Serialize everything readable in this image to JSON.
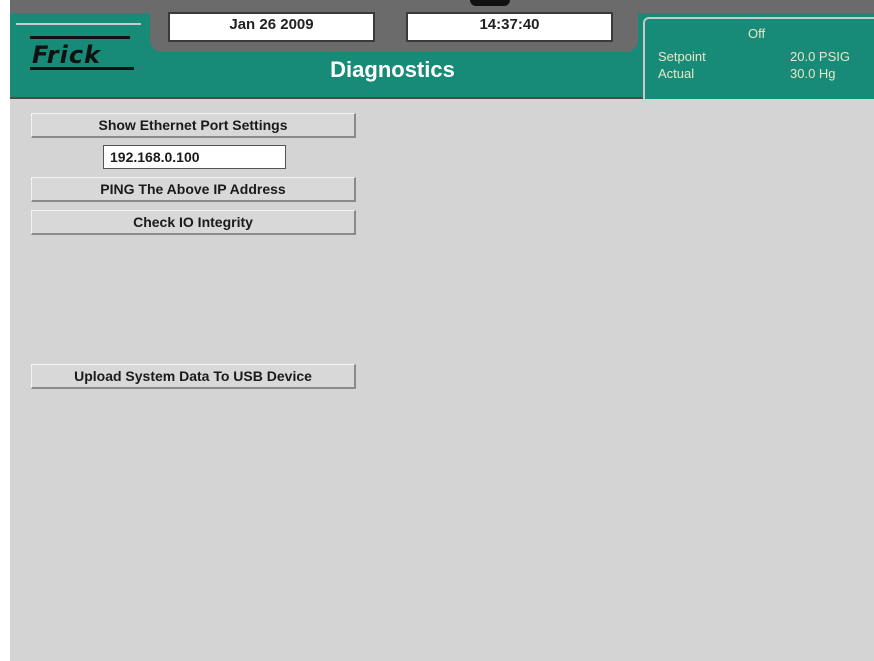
{
  "header": {
    "brand": "Frick",
    "date": "Jan 26 2009",
    "time": "14:37:40",
    "title": "Diagnostics",
    "status": {
      "state": "Off",
      "setpoint_label": "Setpoint",
      "setpoint_value": "20.0 PSIG",
      "actual_label": "Actual",
      "actual_value": "30.0 Hg"
    }
  },
  "main": {
    "show_ethernet_label": "Show Ethernet Port Settings",
    "ip_address": "192.168.0.100",
    "ping_label": "PING The Above IP Address",
    "check_io_label": "Check IO Integrity",
    "upload_usb_label": "Upload System Data To USB Device"
  },
  "colors": {
    "header_teal": "#178a78",
    "header_gray": "#6b6b6b",
    "background": "#d4d4d4",
    "status_text": "#e8e8c8"
  }
}
